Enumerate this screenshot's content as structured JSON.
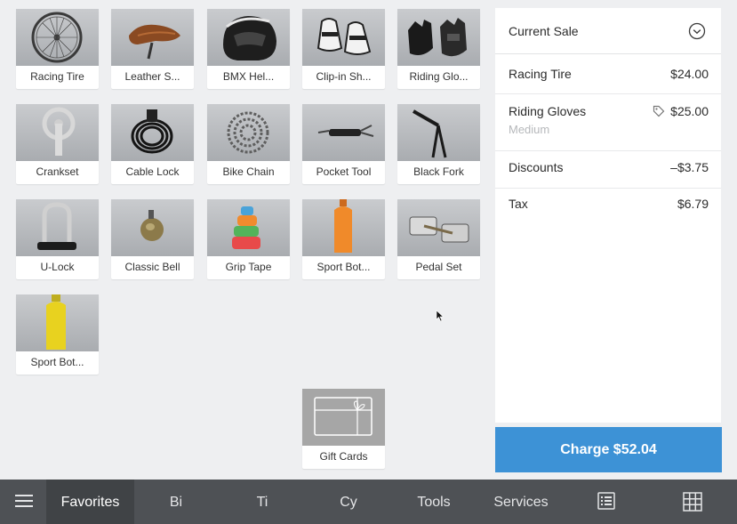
{
  "products": [
    {
      "label": "Racing Tire",
      "icon": "wheel-icon"
    },
    {
      "label": "Leather S...",
      "icon": "saddle-icon"
    },
    {
      "label": "BMX Hel...",
      "icon": "helmet-icon"
    },
    {
      "label": "Clip-in Sh...",
      "icon": "shoes-icon"
    },
    {
      "label": "Riding Glo...",
      "icon": "gloves-icon"
    },
    {
      "label": "Crankset",
      "icon": "crankset-icon"
    },
    {
      "label": "Cable Lock",
      "icon": "cable-lock-icon"
    },
    {
      "label": "Bike Chain",
      "icon": "chain-icon"
    },
    {
      "label": "Pocket Tool",
      "icon": "pocket-tool-icon"
    },
    {
      "label": "Black Fork",
      "icon": "fork-icon"
    },
    {
      "label": "U-Lock",
      "icon": "u-lock-icon"
    },
    {
      "label": "Classic Bell",
      "icon": "bell-icon"
    },
    {
      "label": "Grip Tape",
      "icon": "grip-tape-icon"
    },
    {
      "label": "Sport Bot...",
      "icon": "orange-bottle-icon"
    },
    {
      "label": "Pedal Set",
      "icon": "pedal-icon"
    },
    {
      "label": "Sport Bot...",
      "icon": "yellow-bottle-icon"
    }
  ],
  "gift_card": {
    "label": "Gift Cards",
    "icon": "gift-card-icon"
  },
  "sale": {
    "title": "Current Sale",
    "items": [
      {
        "name": "Racing Tire",
        "price": "$24.00"
      },
      {
        "name": "Riding Gloves",
        "price": "$25.00",
        "variant": "Medium",
        "tag_icon": "discount-tag-icon"
      }
    ],
    "discounts": {
      "name": "Discounts",
      "price": "–$3.75"
    },
    "tax": {
      "name": "Tax",
      "price": "$6.79"
    }
  },
  "charge_button": "Charge $52.04",
  "nav": {
    "menu_icon": "hamburger-menu-icon",
    "tabs": [
      "Favorites",
      "Bi",
      "Ti",
      "Cy",
      "Tools",
      "Services"
    ],
    "active_tab": "Favorites",
    "right_icons": [
      "list-view-icon",
      "grid-view-icon"
    ]
  },
  "colors": {
    "accent": "#3d92d6",
    "nav_bg": "#4e5155",
    "nav_active_bg": "#404346",
    "grid_bg": "#eeeff1"
  }
}
